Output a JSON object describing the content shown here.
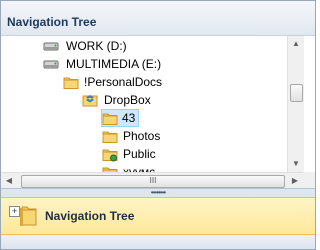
{
  "header": {
    "title": "Navigation Tree"
  },
  "tree": {
    "items": [
      {
        "label": "WORK (D:)",
        "icon": "drive-icon"
      },
      {
        "label": "MULTIMEDIA (E:)",
        "icon": "drive-icon"
      },
      {
        "label": "!PersonalDocs",
        "icon": "folder-icon"
      },
      {
        "label": "DropBox",
        "icon": "dropbox-folder-icon"
      },
      {
        "label": "43",
        "icon": "folder-icon",
        "selected": true
      },
      {
        "label": "Photos",
        "icon": "folder-icon"
      },
      {
        "label": "Public",
        "icon": "public-folder-icon"
      },
      {
        "label": "хуумс",
        "icon": "folder-icon"
      }
    ]
  },
  "scrollbar": {
    "hthumb_grip": "III"
  },
  "splitter": {
    "grip": "••••••••"
  },
  "bottom_panel": {
    "toggle": "+",
    "label": "Navigation Tree"
  },
  "colors": {
    "header_text": "#1e395b",
    "selection": "#cde8ff",
    "bottom_panel": "#ffe89a"
  }
}
